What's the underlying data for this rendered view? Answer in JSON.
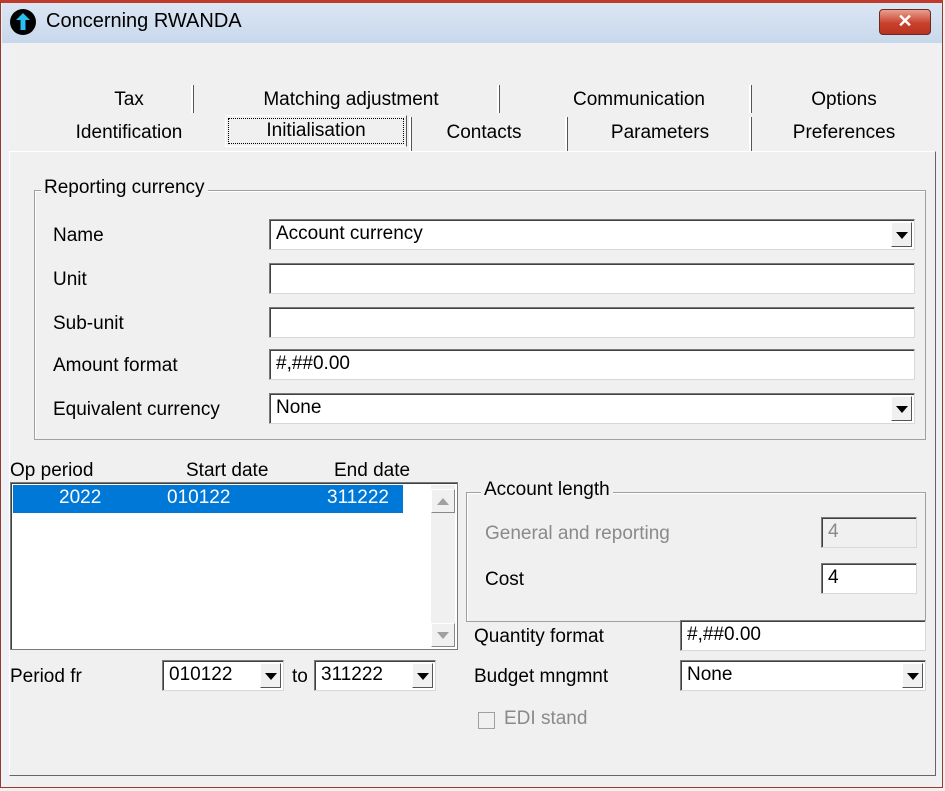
{
  "window": {
    "title": "Concerning RWANDA",
    "close_glyph": "✕"
  },
  "tabs": {
    "row1": [
      "Tax",
      "Matching adjustment",
      "Communication",
      "Options"
    ],
    "row2": [
      "Identification",
      "Initialisation",
      "Contacts",
      "Parameters",
      "Preferences"
    ],
    "active": "Initialisation"
  },
  "reporting_currency": {
    "legend": "Reporting currency",
    "name_label": "Name",
    "name_value": "Account currency",
    "unit_label": "Unit",
    "unit_value": "",
    "subunit_label": "Sub-unit",
    "subunit_value": "",
    "amount_format_label": "Amount format",
    "amount_format_value": "#,##0.00",
    "equivalent_label": "Equivalent currency",
    "equivalent_value": "None"
  },
  "periods": {
    "headers": [
      "Op period",
      "Start date",
      "End date"
    ],
    "rows": [
      {
        "op_period": "2022",
        "start_date": "010122",
        "end_date": "311222"
      }
    ],
    "period_from_label": "Period fr",
    "period_from_value": "010122",
    "to_label": "to",
    "period_to_value": "311222"
  },
  "account_length": {
    "legend": "Account length",
    "general_label": "General and reporting",
    "general_value": "4",
    "cost_label": "Cost",
    "cost_value": "4"
  },
  "quantity_format": {
    "label": "Quantity format",
    "value": "#,##0.00"
  },
  "budget": {
    "label": "Budget mngmnt",
    "value": "None"
  },
  "edi": {
    "label": "EDI stand",
    "checked": false
  },
  "colors": {
    "selection": "#0078d7",
    "close_button": "#c8412c",
    "title_bar": "#c8d8ec"
  },
  "icons": [
    "app-info-icon",
    "close-icon",
    "dropdown-arrow-icon",
    "scroll-up-icon",
    "scroll-down-icon"
  ]
}
